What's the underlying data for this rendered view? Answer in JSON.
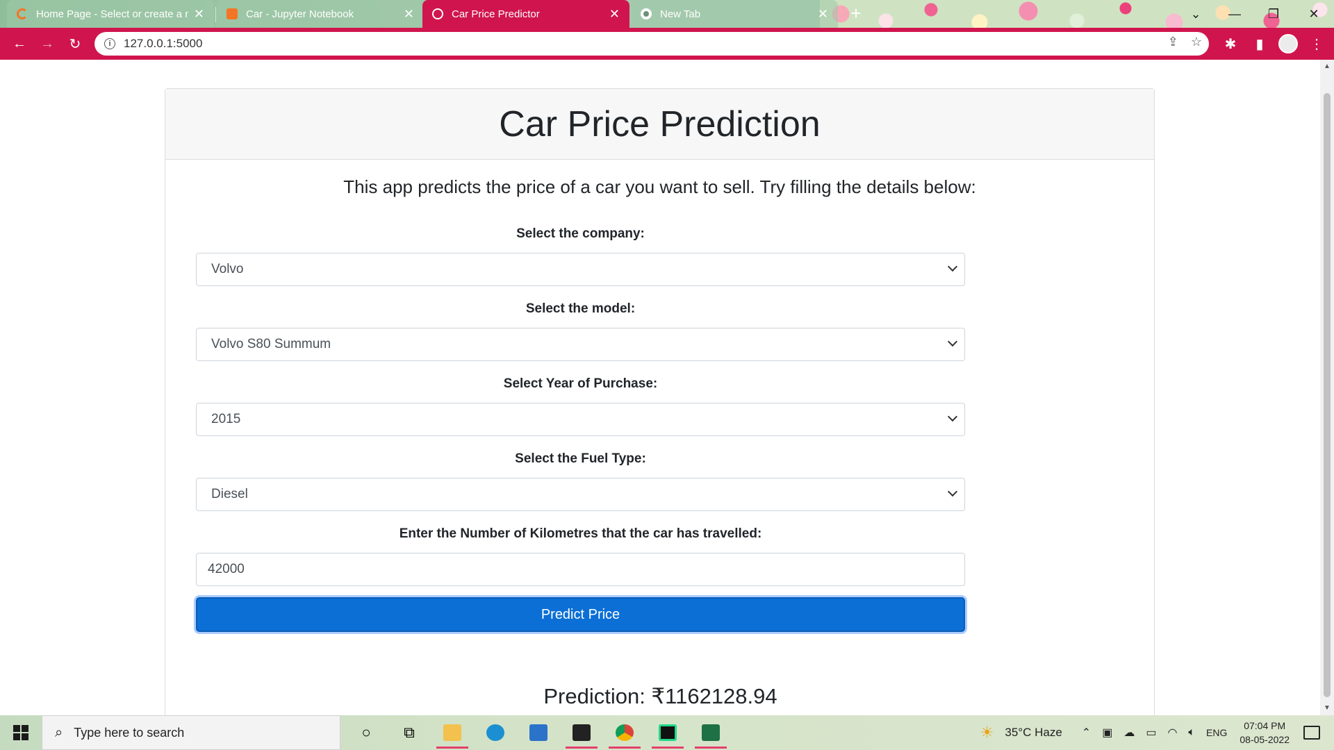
{
  "browser": {
    "tabs": [
      {
        "title": "Home Page - Select or create a n",
        "active": false
      },
      {
        "title": "Car - Jupyter Notebook",
        "active": false
      },
      {
        "title": "Car Price Predictor",
        "active": true
      },
      {
        "title": "New Tab",
        "active": false
      }
    ],
    "url": "127.0.0.1:5000",
    "accent_color": "#d0154e"
  },
  "page": {
    "title": "Car Price Prediction",
    "intro": "This app predicts the price of a car you want to sell. Try filling the details below:",
    "fields": [
      {
        "label": "Select the company:",
        "value": "Volvo",
        "type": "select"
      },
      {
        "label": "Select the model:",
        "value": "Volvo S80 Summum",
        "type": "select"
      },
      {
        "label": "Select Year of Purchase:",
        "value": "2015",
        "type": "select"
      },
      {
        "label": "Select the Fuel Type:",
        "value": "Diesel",
        "type": "select"
      },
      {
        "label": "Enter the Number of Kilometres that the car has travelled:",
        "value": "42000",
        "type": "text"
      }
    ],
    "predict_button": "Predict Price",
    "prediction": "Prediction: ₹1162128.94",
    "button_color": "#0b6fd6"
  },
  "taskbar": {
    "search_placeholder": "Type here to search",
    "weather": "35°C  Haze",
    "language": "ENG",
    "time": "07:04 PM",
    "date": "08-05-2022"
  }
}
